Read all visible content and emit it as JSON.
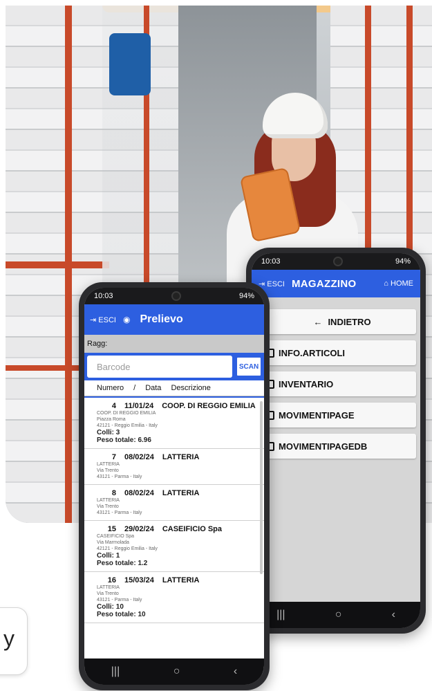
{
  "badge_text": "y",
  "magazzino": {
    "status": {
      "time": "10:03",
      "battery": "94%"
    },
    "appbar": {
      "esci": "ESCI",
      "title": "MAGAZZINO",
      "home": "HOME"
    },
    "back_label": "INDIETRO",
    "menu": [
      "INFO.ARTICOLI",
      "INVENTARIO",
      "MOVIMENTIPAGE",
      "MOVIMENTIPAGEDB"
    ]
  },
  "prelievo": {
    "status": {
      "time": "10:03",
      "battery": "94%"
    },
    "appbar": {
      "esci": "ESCI",
      "title": "Prelievo"
    },
    "ragg_label": "Ragg:",
    "search_placeholder": "Barcode",
    "scan_label": "SCAN",
    "columns": [
      "Numero",
      "/",
      "Data",
      "Descrizione"
    ],
    "items": [
      {
        "numero": "4",
        "data": "11/01/24",
        "descrizione": "COOP. DI REGGIO EMILIA",
        "line1": "COOP. DI REGGIO EMILIA",
        "line2": "Piazza Roma",
        "line3": "42121 - Reggio Emilia - Italy",
        "colli": "Colli: 3",
        "peso": "Peso totale: 6.96"
      },
      {
        "numero": "7",
        "data": "08/02/24",
        "descrizione": "LATTERIA",
        "line1": "LATTERIA",
        "line2": "Via Trento",
        "line3": "43121 - Parma - Italy",
        "colli": "",
        "peso": ""
      },
      {
        "numero": "8",
        "data": "08/02/24",
        "descrizione": "LATTERIA",
        "line1": "LATTERIA",
        "line2": "Via Trento",
        "line3": "43121 - Parma - Italy",
        "colli": "",
        "peso": ""
      },
      {
        "numero": "15",
        "data": "29/02/24",
        "descrizione": "CASEIFICIO Spa",
        "line1": "CASEIFICIO Spa",
        "line2": "Via Marmolada",
        "line3": "42121 - Reggio Emilia - Italy",
        "colli": "Colli: 1",
        "peso": "Peso totale: 1.2"
      },
      {
        "numero": "16",
        "data": "15/03/24",
        "descrizione": "LATTERIA",
        "line1": "LATTERIA",
        "line2": "Via Trento",
        "line3": "43121 - Parma - Italy",
        "colli": "Colli: 10",
        "peso": "Peso totale: 10"
      }
    ]
  }
}
